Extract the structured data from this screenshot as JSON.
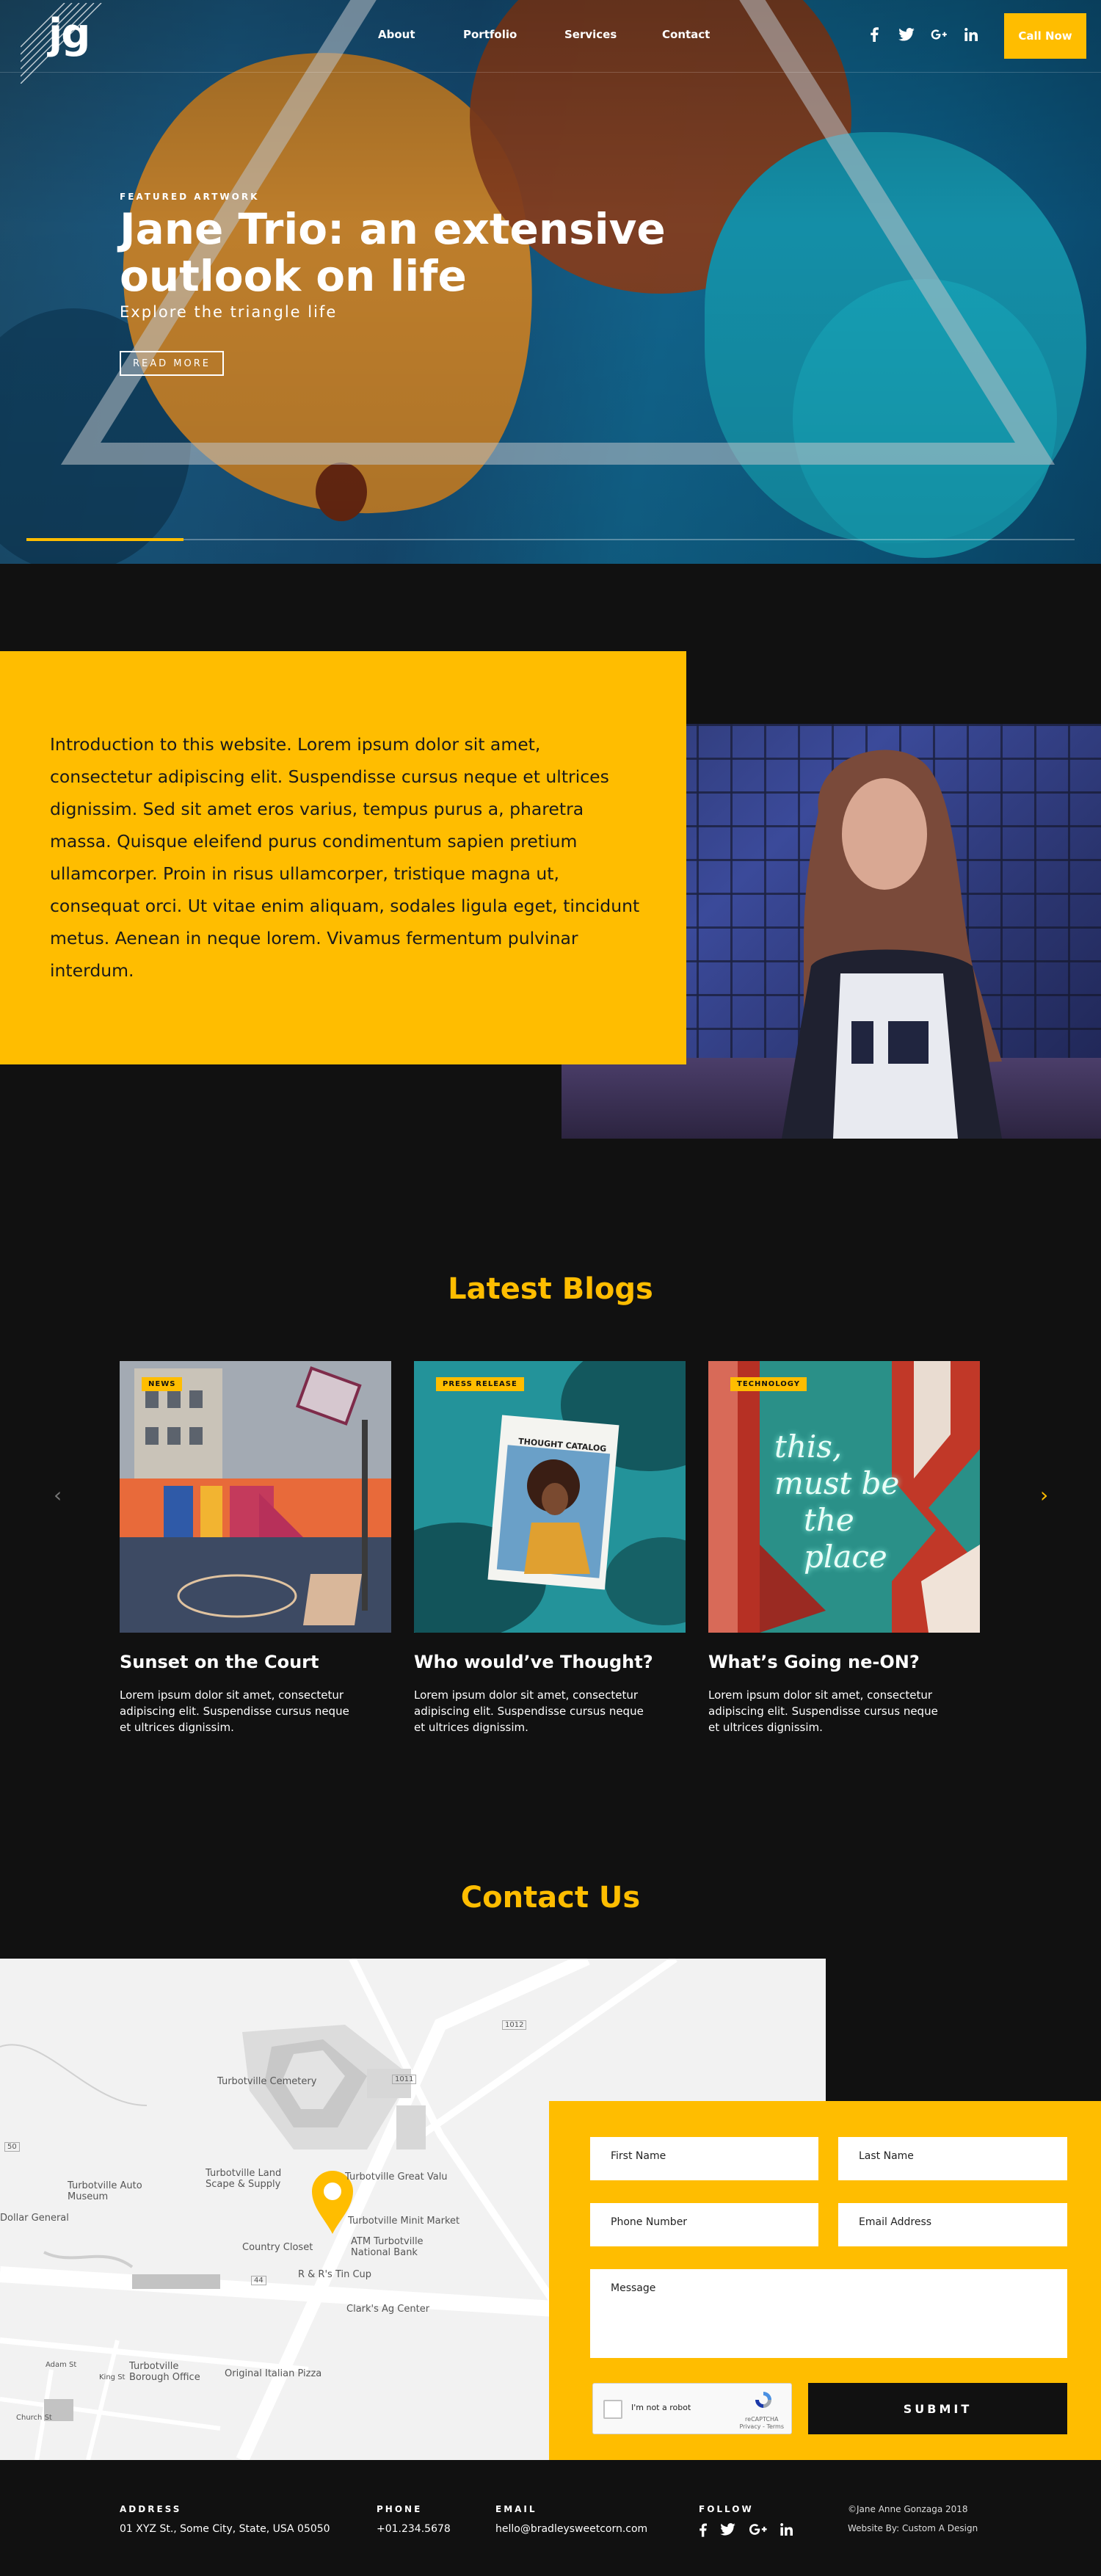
{
  "brand": {
    "logo_text": "jg"
  },
  "nav": {
    "items": [
      "About",
      "Portfolio",
      "Services",
      "Contact"
    ],
    "call_button": "Call Now"
  },
  "social_icons": [
    "facebook-icon",
    "twitter-icon",
    "google-plus-icon",
    "linkedin-icon"
  ],
  "hero": {
    "label": "FEATURED ARTWORK",
    "title": "Jane Trio: an extensive outlook on life",
    "subtitle": "Explore the triangle life",
    "button": "READ MORE",
    "slider_progress": 0.15
  },
  "intro": {
    "text": "Introduction to this website. Lorem ipsum dolor sit amet, consectetur adipiscing elit. Suspendisse cursus neque et ultrices dignissim. Sed sit amet eros varius, tempus purus a, pharetra massa. Quisque eleifend purus condimentum sapien pretium ullamcorper. Proin in risus ullamcorper, tristique magna ut, consequat orci. Ut vitae enim aliquam, sodales ligula eget, tincidunt metus. Aenean in neque lorem. Vivamus fermentum pulvinar interdum."
  },
  "blogs": {
    "title": "Latest Blogs",
    "prev": "‹",
    "next": "›",
    "posts": [
      {
        "badge": "NEWS",
        "title": "Sunset on the Court",
        "excerpt": "Lorem ipsum dolor sit amet, consectetur adipiscing elit. Suspendisse cursus neque et ultrices dignissim."
      },
      {
        "badge": "PRESS RELEASE",
        "title": "Who would’ve Thought?",
        "excerpt": "Lorem ipsum dolor sit amet, consectetur adipiscing elit. Suspendisse cursus neque et ultrices dignissim.",
        "magazine_title": "THOUGHT CATALOG"
      },
      {
        "badge": "TECHNOLOGY",
        "title": "What’s Going ne-ON?",
        "excerpt": "Lorem ipsum dolor sit amet, consectetur adipiscing elit. Suspendisse cursus neque et ultrices dignissim.",
        "neon_lines": [
          "this,",
          "must be",
          "the place"
        ]
      }
    ]
  },
  "contact": {
    "title": "Contact Us",
    "map_labels": [
      "Turbotville Cemetery",
      "Turbotville Land Scape & Supply",
      "Turbotville Auto Museum",
      "Dollar General",
      "Turbotville Great Valu",
      "Turbotville Minit Market",
      "ATM Turbotville National Bank",
      "Country Closet",
      "R & R's Tin Cup",
      "Clark's Ag Center",
      "Turbotville Borough Office",
      "Original Italian Pizza",
      "Adam St",
      "King St",
      "Church St",
      "1011",
      "1012",
      "50",
      "44"
    ],
    "form": {
      "first_name": "First Name",
      "last_name": "Last Name",
      "phone": "Phone Number",
      "email": "Email Address",
      "message": "Message",
      "captcha_label": "I'm not a robot",
      "captcha_brand": "reCAPTCHA",
      "captcha_terms": "Privacy - Terms",
      "submit": "SUBMIT"
    }
  },
  "footer": {
    "address_label": "ADDRESS",
    "address": "01 XYZ St., Some City, State, USA 05050",
    "phone_label": "PHONE",
    "phone": "+01.234.5678",
    "email_label": "EMAIL",
    "email": "hello@bradleysweetcorn.com",
    "follow_label": "FOLLOW",
    "copyright": "©Jane Anne Gonzaga 2018",
    "credit": "Website By: Custom A Design"
  },
  "colors": {
    "accent": "#ffbd00",
    "background": "#111111"
  }
}
